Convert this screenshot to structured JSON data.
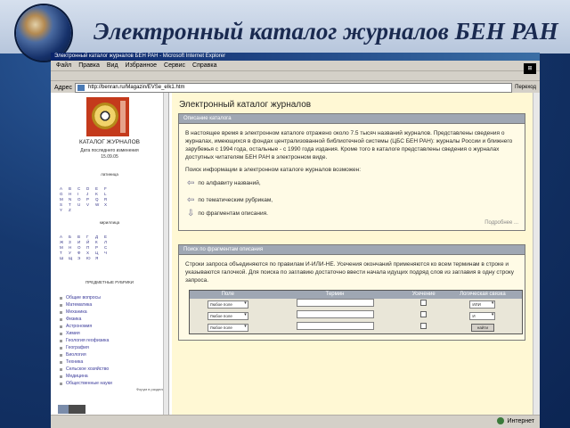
{
  "slide": {
    "title": "Электронный каталог журналов БЕН РАН"
  },
  "browser": {
    "title_bar": "Электронный каталог журналов БЕН РАН - Microsoft Internet Explorer",
    "menu": [
      "Файл",
      "Правка",
      "Вид",
      "Избранное",
      "Сервис",
      "Справка"
    ],
    "address_label": "Адрес",
    "address_url": "http://benran.ru/Magazin/EVSe_eIk1.htm",
    "go_label": "Переход",
    "status_zone": "Интернет"
  },
  "left_frame": {
    "catalog_title": "КАТАЛОГ ЖУРНАЛОВ",
    "updated_label": "Дата последнего изменения",
    "updated_date": "15.09.05",
    "latin_label": "латиница",
    "latin_letters": [
      "A",
      "B",
      "C",
      "D",
      "E",
      "F",
      "G",
      "H",
      "I",
      "J",
      "K",
      "L",
      "M",
      "N",
      "O",
      "P",
      "Q",
      "R",
      "S",
      "T",
      "U",
      "V",
      "W",
      "X",
      "Y",
      "Z"
    ],
    "cyrillic_label": "кириллица",
    "cyrillic_letters": [
      "А",
      "Б",
      "В",
      "Г",
      "Д",
      "Е",
      "Ж",
      "З",
      "И",
      "Й",
      "К",
      "Л",
      "М",
      "Н",
      "О",
      "П",
      "Р",
      "С",
      "Т",
      "У",
      "Ф",
      "Х",
      "Ц",
      "Ч",
      "Ш",
      "Щ",
      "Э",
      "Ю",
      "Я"
    ],
    "rubrics_label": "ПРЕДМЕТНЫЕ РУБРИКИ",
    "rubrics": [
      "Общие вопросы",
      "Математика",
      "Механика",
      "Физика",
      "Астрономия",
      "Химия",
      "Геология геофизика",
      "География",
      "Биология",
      "Техника",
      "Сельское хозяйство",
      "Медицина",
      "Общественные науки"
    ],
    "forum_link": "Форум в разделе"
  },
  "main": {
    "page_title": "Электронный каталог журналов",
    "description": {
      "header": "Описание каталога",
      "paragraph1": "В настоящее время в электронном каталоге отражено около 7.5 тысяч названий журналов. Представлены сведения о журналах, имеющихся в фондах централизованной библиотечной системы (ЦБС БЕН РАН): журналы России и ближнего зарубежья с 1994 года, остальные - с 1990 года издания. Кроме того в каталоге представлены сведения о журналах доступных читателям БЕН РАН в электронном виде.",
      "paragraph2": "Поиск информации в электронном каталоге журналов возможен:",
      "options": [
        "по алфавиту названий,",
        "по тематическим рубрикам,",
        "по фрагментам описания."
      ],
      "more": "Подробнее ..."
    },
    "fragment_search": {
      "header": "Поиск по фрагментам описания",
      "instructions": "Строки запроса объединяются по правилам И-ИЛИ-НЕ. Усечения окончаний применяются ко всем терминам в строке и указываются галочкой. Для поиска по заглавию достаточно ввести начала идущих подряд слов из заглавия в одну строку запроса.",
      "columns": [
        "Поле",
        "Термин",
        "Усечение",
        "Логическая связка"
      ],
      "rows": [
        {
          "field": "Любое поле",
          "logic": "ИЛИ"
        },
        {
          "field": "Любое поле",
          "logic": "И"
        },
        {
          "field": "Любое поле",
          "logic": ""
        }
      ],
      "find_button": "найти"
    }
  },
  "colors": {
    "slide_header_bg": "#c5d2e4",
    "panel_header_bg": "#9fa7b3",
    "page_bg": "#fff8d4",
    "link_blue": "#3b3b9a"
  }
}
